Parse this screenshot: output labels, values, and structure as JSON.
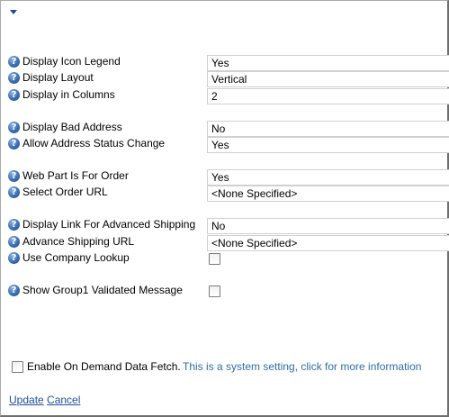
{
  "settings": {
    "display_icon_legend": {
      "label": "Display Icon Legend",
      "value": "Yes"
    },
    "display_layout": {
      "label": "Display Layout",
      "value": "Vertical"
    },
    "display_in_columns": {
      "label": "Display in Columns",
      "value": "2"
    },
    "display_bad_address": {
      "label": "Display Bad Address",
      "value": "No"
    },
    "allow_address_status_change": {
      "label": "Allow Address Status Change",
      "value": "Yes"
    },
    "web_part_is_for_order": {
      "label": "Web Part Is For Order",
      "value": "Yes"
    },
    "select_order_url": {
      "label": "Select Order URL",
      "value": "<None Specified>"
    },
    "display_link_for_advanced_shipping": {
      "label": "Display Link For Advanced Shipping",
      "value": "No"
    },
    "advance_shipping_url": {
      "label": "Advance Shipping URL",
      "value": "<None Specified>"
    },
    "use_company_lookup": {
      "label": "Use Company Lookup",
      "checked": false
    },
    "show_group1_validated_message": {
      "label": "Show Group1 Validated Message",
      "checked": false
    }
  },
  "on_demand": {
    "label": "Enable On Demand Data Fetch.",
    "link_text": "This is a system setting, click for more information",
    "checked": false
  },
  "actions": {
    "update": "Update",
    "cancel": "Cancel"
  },
  "icons": {
    "help": "question-mark-help-icon",
    "toggle": "triangle-down-icon"
  },
  "colors": {
    "link": "#2f6ea5",
    "help_icon": "#3a6fb5",
    "toggle_arrow": "#1c4e9a"
  }
}
